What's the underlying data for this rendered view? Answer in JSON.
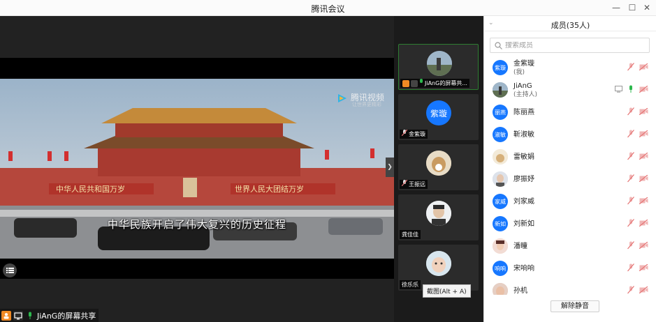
{
  "window": {
    "title": "腾讯会议",
    "minimize": "—",
    "maximize": "☐",
    "close": "✕"
  },
  "video": {
    "subtitle": "中华民族开启了伟大复兴的历史征程",
    "watermark_main": "腾讯视频",
    "watermark_sub": "让世界更精彩",
    "banner_left": "中华人民共和国万岁",
    "banner_right": "世界人民大团结万岁",
    "share_label": "JiAnG的屏幕共享"
  },
  "thumbnails": [
    {
      "name": "JiAnG的屏幕共..."
    },
    {
      "name": "金紫璇",
      "avatar_text": "紫璇"
    },
    {
      "name": "王振远"
    },
    {
      "name": "龚佳佳"
    },
    {
      "name": "徐乐乐"
    }
  ],
  "tooltip": "截图(Alt + A)",
  "panel": {
    "title": "成员(35人)",
    "search_placeholder": "搜索成员",
    "unmute_all": "解除静音",
    "members": [
      {
        "avatar": "紫璇",
        "name": "金紫璇",
        "sub": "(我)",
        "mic": "muted",
        "cam": "off"
      },
      {
        "avatar": "",
        "name": "JiAnG",
        "sub": "(主持人)",
        "mic": "on",
        "cam": "off",
        "share": true
      },
      {
        "avatar": "丽燕",
        "name": "陈丽燕",
        "sub": "",
        "mic": "muted",
        "cam": "off"
      },
      {
        "avatar": "淑敏",
        "name": "靳淑敏",
        "sub": "",
        "mic": "muted",
        "cam": "off"
      },
      {
        "avatar": "",
        "name": "雷敏娟",
        "sub": "",
        "mic": "muted",
        "cam": "off"
      },
      {
        "avatar": "",
        "name": "廖振妤",
        "sub": "",
        "mic": "muted",
        "cam": "off"
      },
      {
        "avatar": "家威",
        "name": "刘家威",
        "sub": "",
        "mic": "muted",
        "cam": "off"
      },
      {
        "avatar": "新如",
        "name": "刘新如",
        "sub": "",
        "mic": "muted",
        "cam": "off"
      },
      {
        "avatar": "",
        "name": "潘瞳",
        "sub": "",
        "mic": "muted",
        "cam": "off"
      },
      {
        "avatar": "响响",
        "name": "宋响响",
        "sub": "",
        "mic": "muted",
        "cam": "off"
      },
      {
        "avatar": "",
        "name": "孙机",
        "sub": "",
        "mic": "muted",
        "cam": "off"
      }
    ]
  },
  "colors": {
    "accent": "#1677ff",
    "mic_on": "#2db84d",
    "muted": "#e57373",
    "active_border": "#2e7d32"
  }
}
